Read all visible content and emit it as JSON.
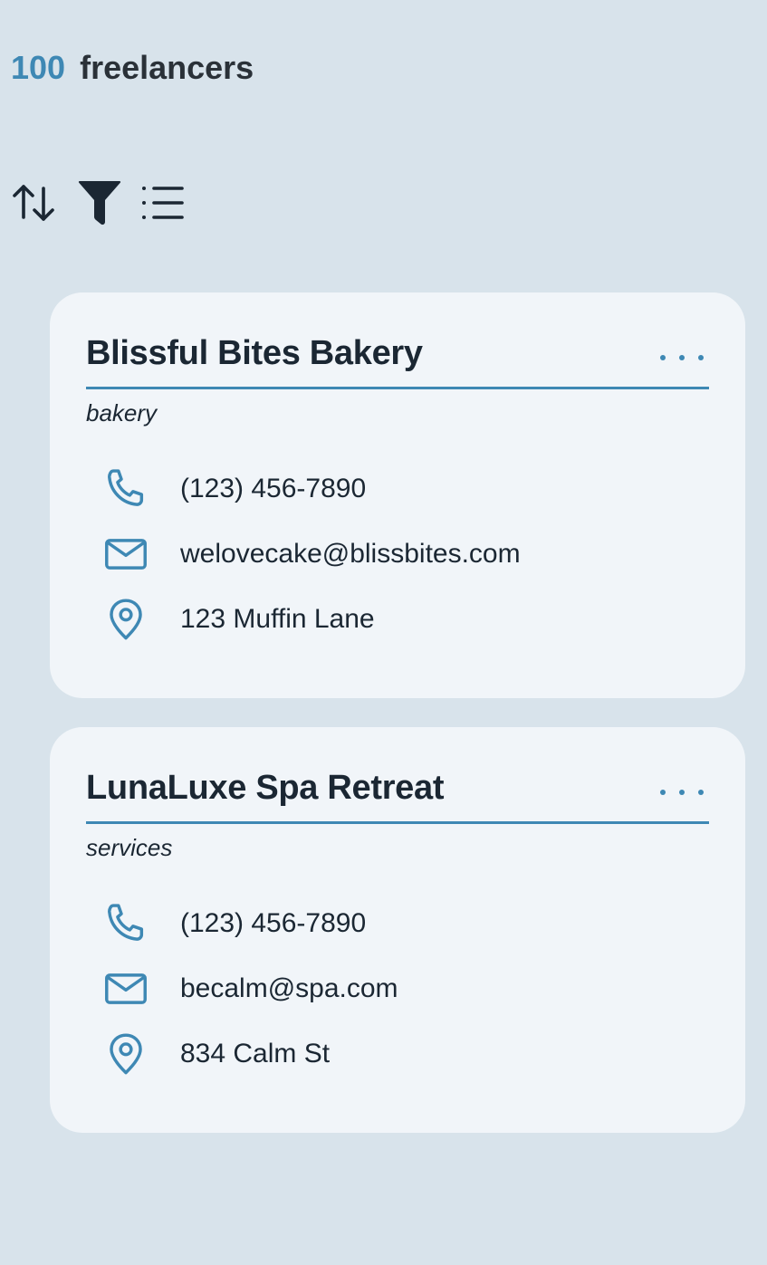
{
  "header": {
    "count": "100",
    "label": "freelancers"
  },
  "toolbar": {
    "sort_icon": "sort-arrows-icon",
    "filter_icon": "filter-funnel-icon",
    "list_icon": "list-view-icon"
  },
  "colors": {
    "accent": "#3e88b4",
    "background": "#d8e3eb",
    "card": "#f1f5f9",
    "text": "#1b2733"
  },
  "cards": [
    {
      "name": "Blissful Bites Bakery",
      "category": "bakery",
      "phone": "(123) 456-7890",
      "email": "welovecake@blissbites.com",
      "address": "123 Muffin Lane"
    },
    {
      "name": "LunaLuxe Spa Retreat",
      "category": "services",
      "phone": "(123) 456-7890",
      "email": "becalm@spa.com",
      "address": "834 Calm St"
    }
  ]
}
